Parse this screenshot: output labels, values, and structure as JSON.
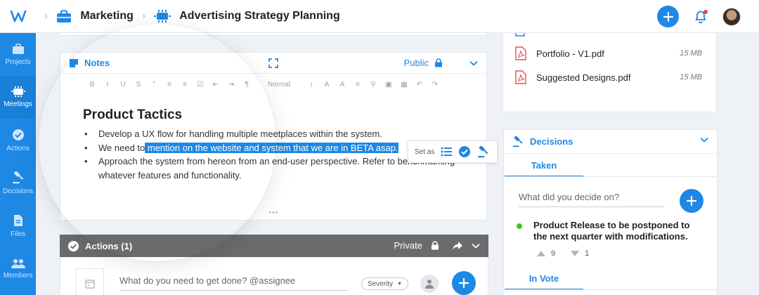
{
  "header": {
    "breadcrumbs": [
      {
        "label": "Marketing",
        "icon": "briefcase-icon"
      },
      {
        "label": "Advertising Strategy Planning",
        "icon": "meeting-icon"
      }
    ]
  },
  "sidebar": {
    "items": [
      {
        "label": "Projects",
        "icon": "briefcase-icon",
        "active": false
      },
      {
        "label": "Meetings",
        "icon": "meeting-icon",
        "active": true
      },
      {
        "label": "Actions",
        "icon": "check-circle-icon",
        "active": false
      },
      {
        "label": "Decisions",
        "icon": "gavel-icon",
        "active": false
      },
      {
        "label": "Files",
        "icon": "file-icon",
        "active": false
      },
      {
        "label": "Members",
        "icon": "people-icon",
        "active": false
      }
    ]
  },
  "notes": {
    "title": "Notes",
    "visibility": "Public",
    "toolbar": [
      "B",
      "I",
      "U",
      "S",
      "”",
      "≡",
      "≡",
      "☑",
      "⇤",
      "⇥",
      "¶",
      "Normal",
      "↕",
      "A",
      "A",
      "≡",
      "ὑ7",
      "▣",
      "▦",
      "↶",
      "↷"
    ],
    "toolbar_format": "Normal",
    "heading": "Product Tactics",
    "bullets": {
      "b1": "Develop a UX flow for handling multiple meetplaces within the system.",
      "b2_pre": "We need to",
      "b2_hl": " mention on the website and system that we are in BETA asap.",
      "b3": "Approach the system from hereon from an end-user perspective. Refer to benchmarking whatever features and functionality."
    },
    "set_as_label": "Set as"
  },
  "actions": {
    "title": "Actions (1)",
    "visibility": "Private",
    "input_placeholder": "What do you need to get done?  @assignee",
    "severity_label": "Severity"
  },
  "files": {
    "items": [
      {
        "name": "Portfolio - V1.pdf",
        "size": "15 MB"
      },
      {
        "name": "Suggested Designs.pdf",
        "size": "15 MB"
      }
    ]
  },
  "decisions": {
    "title": "Decisions",
    "tab_taken": "Taken",
    "tab_vote": "In Vote",
    "input_placeholder": "What did you decide on?",
    "item": "Product Release to be postponed to the next quarter with modifications.",
    "up_votes": "9",
    "down_votes": "1"
  },
  "colors": {
    "accent": "#1e88e5",
    "actions_bar": "#6b6b6b",
    "status_green": "#43c31c"
  }
}
